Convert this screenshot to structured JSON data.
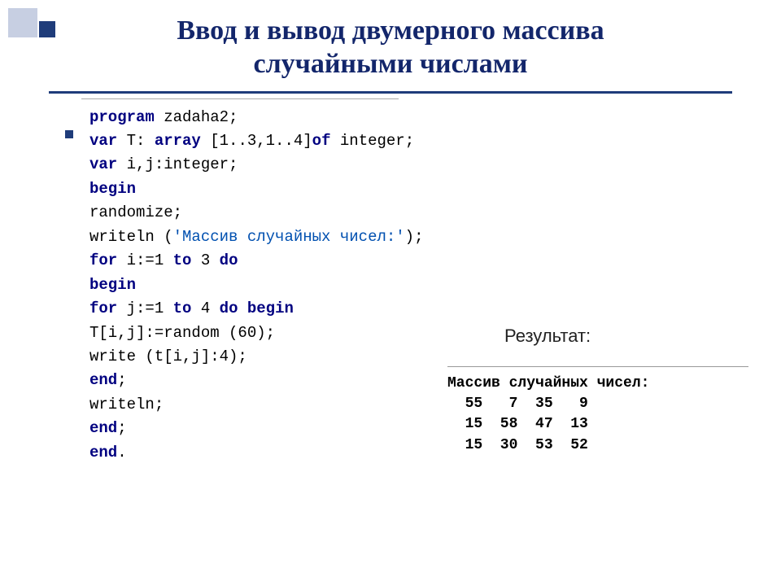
{
  "title_line1": "Ввод и вывод двумерного массива",
  "title_line2": "случайными числами",
  "code": {
    "l1a": "program",
    "l1b": " zadaha2;",
    "l2a": "var",
    "l2b": " T: ",
    "l2c": "array",
    "l2d": " [1..3,1..4]",
    "l2e": "of",
    "l2f": " integer;",
    "l3a": "var",
    "l3b": " i,j:integer;",
    "l4": "begin",
    "l5": "randomize;",
    "l6a": "writeln (",
    "l6b": "'Массив случайных чисел:'",
    "l6c": ");",
    "l7a": "for",
    "l7b": " i:=1 ",
    "l7c": "to",
    "l7d": " 3 ",
    "l7e": "do",
    "l8": "begin",
    "l9a": "for",
    "l9b": " j:=1 ",
    "l9c": "to",
    "l9d": " 4 ",
    "l9e": "do begin",
    "l10": "T[i,j]:=random (60);",
    "l11": "write (t[i,j]:4);",
    "l12a": "end",
    "l12b": ";",
    "l13": "writeln;",
    "l14a": "end",
    "l14b": ";",
    "l15a": "end",
    "l15b": "."
  },
  "result_label": "Результат:",
  "result_header": "Массив случайных чисел:",
  "result_rows": [
    [
      55,
      7,
      35,
      9
    ],
    [
      15,
      58,
      47,
      13
    ],
    [
      15,
      30,
      53,
      52
    ]
  ]
}
